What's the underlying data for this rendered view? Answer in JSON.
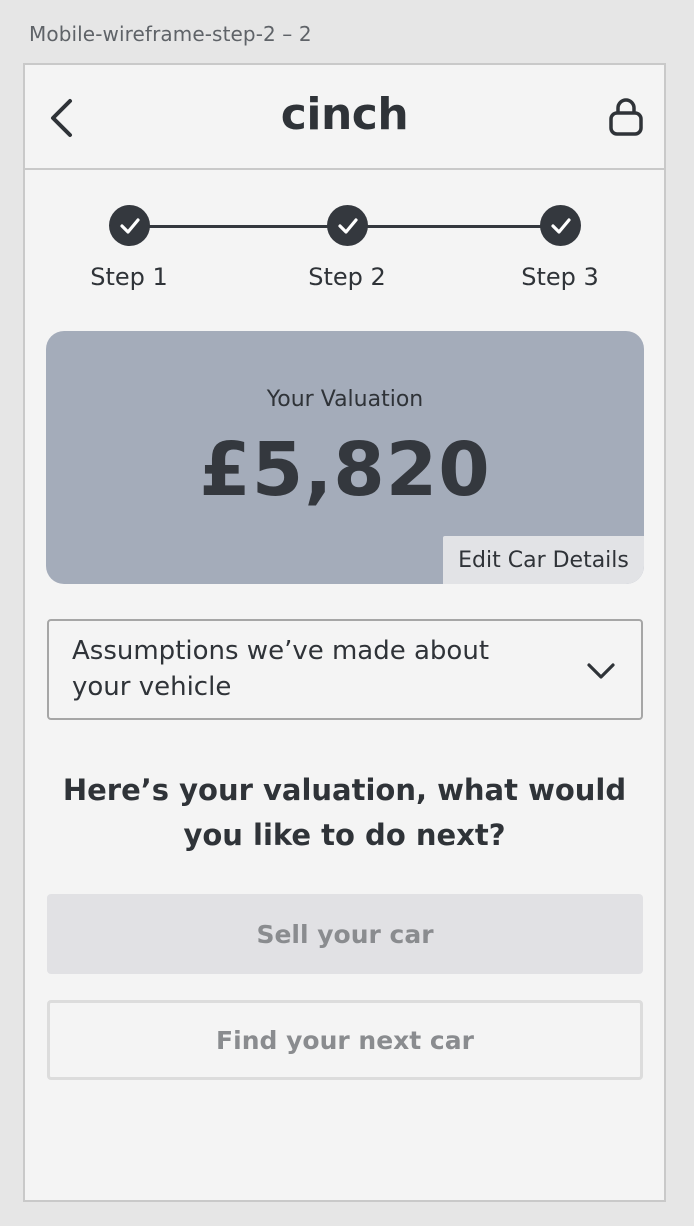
{
  "artboard": {
    "label": "Mobile-wireframe-step-2 – 2"
  },
  "header": {
    "logo": "cinch",
    "back_icon": "chevron-left-icon",
    "lock_icon": "lock-icon"
  },
  "stepper": {
    "steps": [
      {
        "label": "Step 1",
        "status": "complete"
      },
      {
        "label": "Step 2",
        "status": "complete"
      },
      {
        "label": "Step 3",
        "status": "complete"
      }
    ],
    "color": "#34383e"
  },
  "valuation": {
    "label": "Your Valuation",
    "amount": "£5,820",
    "edit_label": "Edit Car Details",
    "card_color": "#a4acba"
  },
  "assumptions": {
    "text": "Assumptions we’ve made about your vehicle",
    "icon": "chevron-down-icon"
  },
  "prompt": "Here’s your valuation, what would you like to do next?",
  "actions": {
    "sell_label": "Sell your car",
    "find_label": "Find your next car"
  }
}
